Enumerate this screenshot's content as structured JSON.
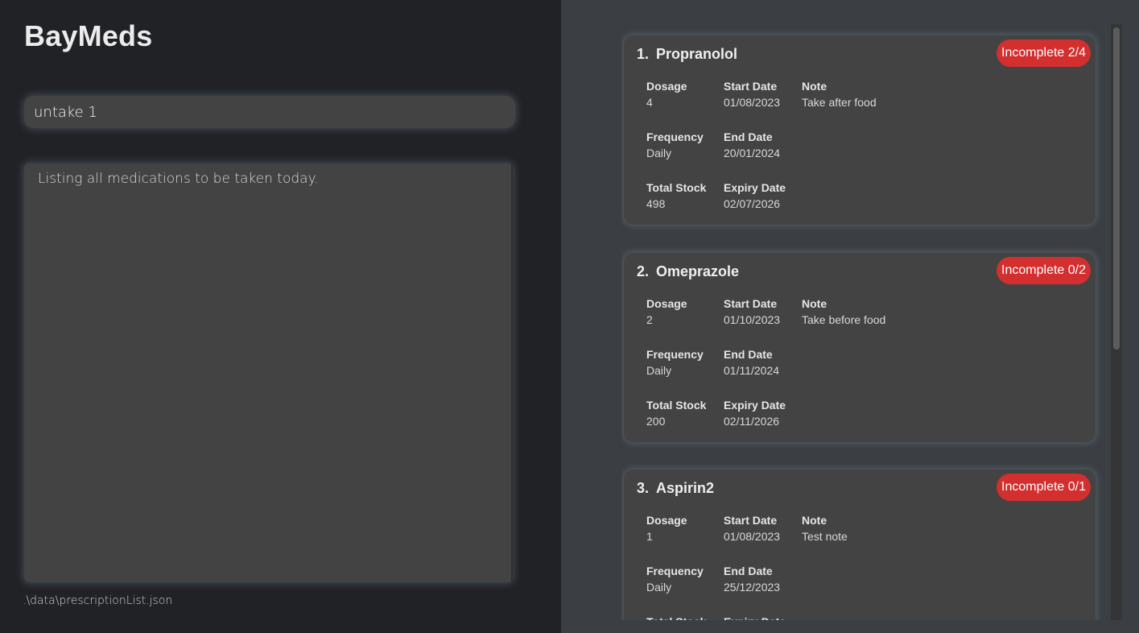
{
  "app": {
    "title": "BayMeds"
  },
  "command": {
    "value": "untake 1",
    "placeholder": ""
  },
  "result": {
    "message": "Listing all medications to be taken today."
  },
  "status_bar": {
    "file_path": ".\\data\\prescriptionList.json"
  },
  "colors": {
    "badge_incomplete": "#d32f2f",
    "left_background": "#212226",
    "right_background": "#3b3f43",
    "card_background": "#434343"
  },
  "labels": {
    "dosage": "Dosage",
    "start_date": "Start Date",
    "note": "Note",
    "frequency": "Frequency",
    "end_date": "End Date",
    "total_stock": "Total Stock",
    "expiry_date": "Expiry Date"
  },
  "prescriptions": [
    {
      "index": "1.",
      "name": "Propranolol",
      "status": "Incomplete 2/4",
      "dosage": "4",
      "start_date": "01/08/2023",
      "note": "Take after food",
      "frequency": "Daily",
      "end_date": "20/01/2024",
      "total_stock": "498",
      "expiry_date": "02/07/2026"
    },
    {
      "index": "2.",
      "name": "Omeprazole",
      "status": "Incomplete 0/2",
      "dosage": "2",
      "start_date": "01/10/2023",
      "note": "Take before food",
      "frequency": "Daily",
      "end_date": "01/11/2024",
      "total_stock": "200",
      "expiry_date": "02/11/2026"
    },
    {
      "index": "3.",
      "name": "Aspirin2",
      "status": "Incomplete 0/1",
      "dosage": "1",
      "start_date": "01/08/2023",
      "note": "Test note",
      "frequency": "Daily",
      "end_date": "25/12/2023",
      "total_stock": "",
      "expiry_date": ""
    }
  ]
}
